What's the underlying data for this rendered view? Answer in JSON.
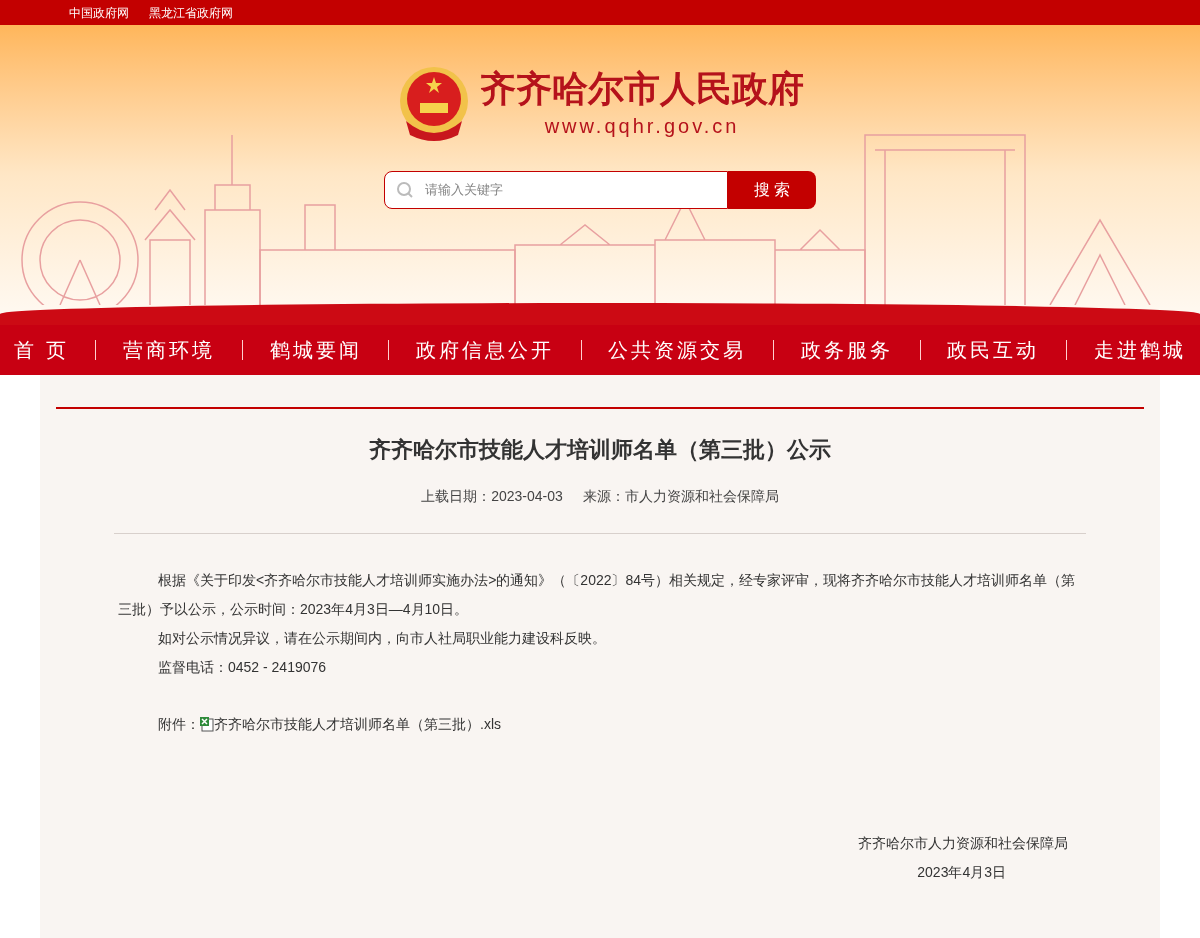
{
  "top_links": [
    "中国政府网",
    "黑龙江省政府网"
  ],
  "site": {
    "name": "齐齐哈尔市人民政府",
    "url": "www.qqhr.gov.cn"
  },
  "search": {
    "placeholder": "请输入关键字",
    "button": "搜 索"
  },
  "nav": [
    {
      "label": "首 页"
    },
    {
      "label": "营商环境"
    },
    {
      "label": "鹤城要闻"
    },
    {
      "label": "政府信息公开"
    },
    {
      "label": "公共资源交易"
    },
    {
      "label": "政务服务"
    },
    {
      "label": "政民互动"
    },
    {
      "label": "走进鹤城"
    }
  ],
  "article": {
    "title": "齐齐哈尔市技能人才培训师名单（第三批）公示",
    "date": "上载日期：2023-04-03",
    "source": "来源：市人力资源和社会保障局",
    "paragraphs": [
      "根据《关于印发<齐齐哈尔市技能人才培训师实施办法>的通知》（〔2022〕84号）相关规定，经专家评审，现将齐齐哈尔市技能人才培训师名单（第三批）予以公示，公示时间：2023年4月3日—4月10日。",
      "如对公示情况异议，请在公示期间内，向市人社局职业能力建设科反映。",
      "监督电话：0452 - 2419076"
    ],
    "attachment_label": "附件：",
    "attachment_file": "齐齐哈尔市技能人才培训师名单（第三批）.xls",
    "signature": [
      "齐齐哈尔市人力资源和社会保障局",
      "2023年4月3日"
    ]
  }
}
